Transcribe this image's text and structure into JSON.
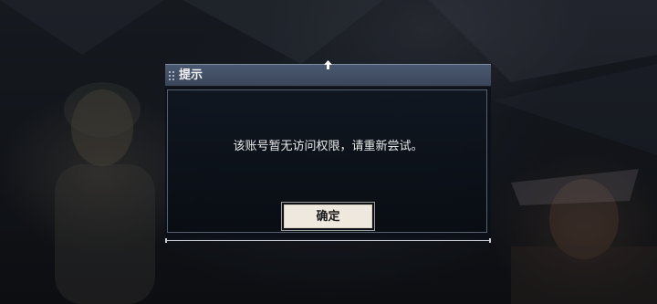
{
  "dialog": {
    "title": "提示",
    "message": "该账号暂无访问权限，请重新尝试。",
    "confirm_label": "确定"
  },
  "icons": {
    "grip": "drag-grip-icon",
    "pin": "pin-icon"
  },
  "colors": {
    "header": "#3f4c60",
    "button_bg": "#efe8de",
    "panel_border": "#56606f"
  }
}
